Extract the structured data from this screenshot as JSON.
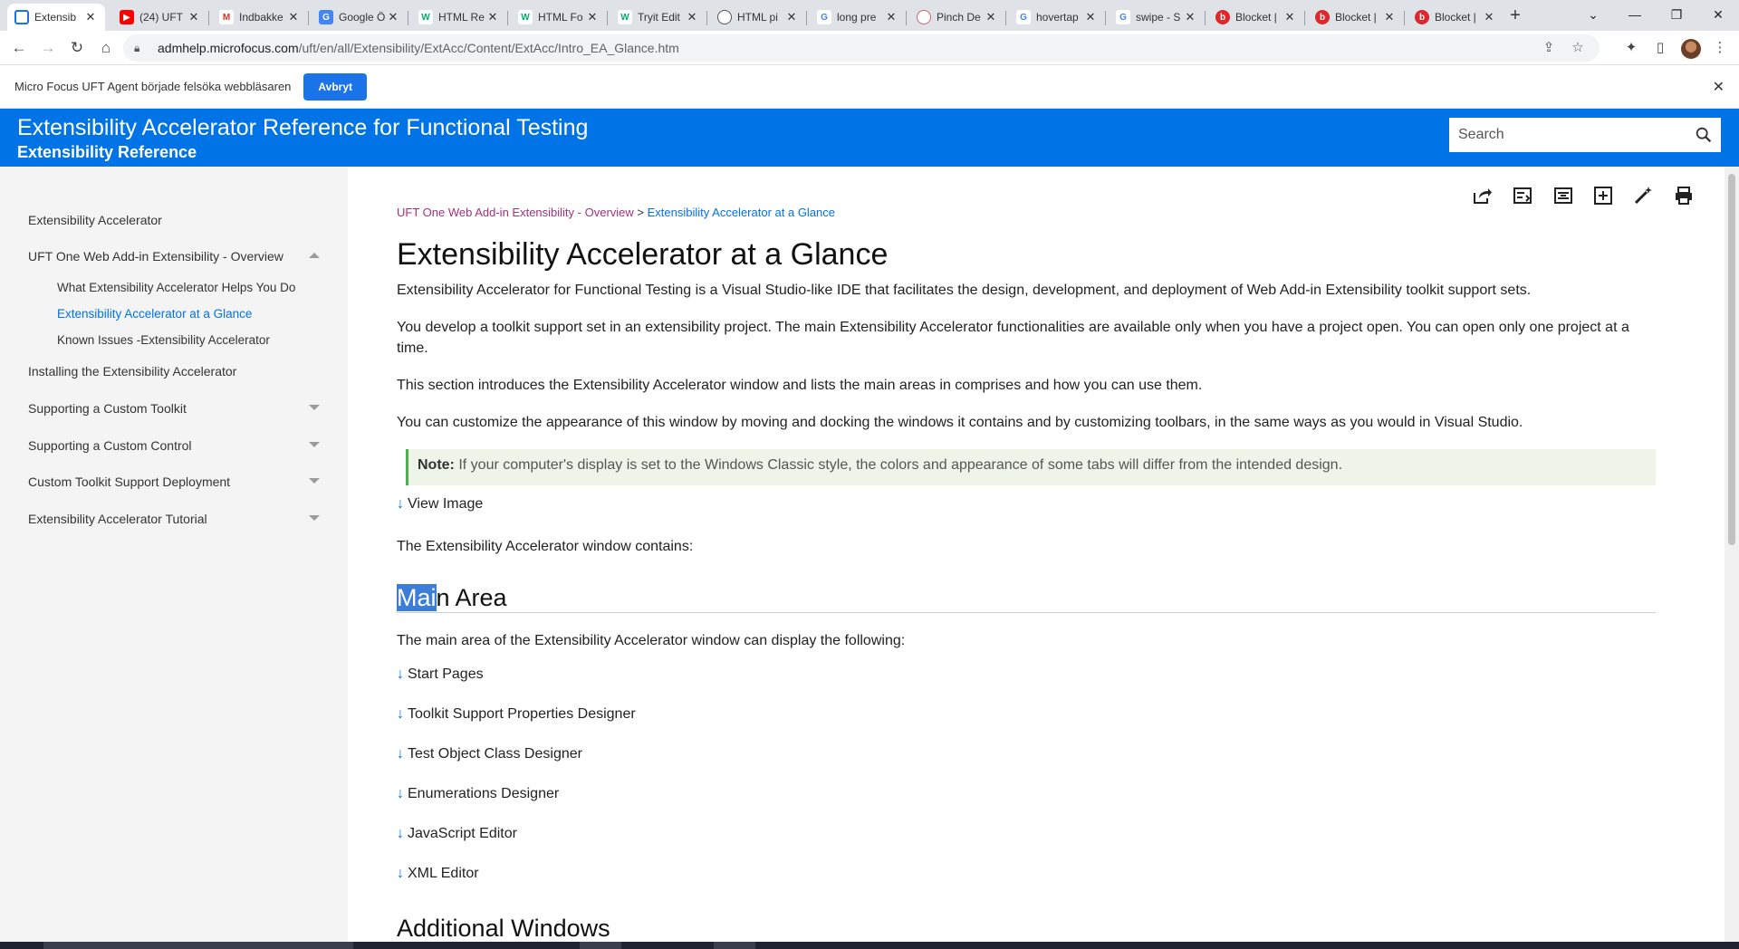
{
  "browser": {
    "tabs": [
      {
        "label": "Extensib",
        "icon": "microfocus-icon",
        "color": "#1a73e8"
      },
      {
        "label": "(24) UFT",
        "icon": "youtube-icon",
        "color": "#ff0000"
      },
      {
        "label": "Indbakke",
        "icon": "gmail-icon",
        "color": "#d93025"
      },
      {
        "label": "Google Ö",
        "icon": "translate-icon",
        "color": "#4285f4"
      },
      {
        "label": "HTML Re",
        "icon": "w3schools-icon",
        "color": "#04aa6d"
      },
      {
        "label": "HTML Fo",
        "icon": "w3schools-icon",
        "color": "#04aa6d"
      },
      {
        "label": "Tryit Edit",
        "icon": "w3schools-icon",
        "color": "#04aa6d"
      },
      {
        "label": "HTML pi",
        "icon": "globe-icon",
        "color": "#555555"
      },
      {
        "label": "long pre",
        "icon": "google-icon",
        "color": "#4285f4"
      },
      {
        "label": "Pinch De",
        "icon": "site-icon",
        "color": "#cc6666"
      },
      {
        "label": "hovertap",
        "icon": "google-icon",
        "color": "#4285f4"
      },
      {
        "label": "swipe - S",
        "icon": "google-icon",
        "color": "#4285f4"
      },
      {
        "label": "Blocket |",
        "icon": "blocket-icon",
        "color": "#e0262a"
      },
      {
        "label": "Blocket |",
        "icon": "blocket-icon",
        "color": "#e0262a"
      },
      {
        "label": "Blocket |",
        "icon": "blocket-icon",
        "color": "#e0262a"
      }
    ],
    "url_host": "admhelp.microfocus.com",
    "url_path": "/uft/en/all/Extensibility/ExtAcc/Content/ExtAcc/Intro_EA_Glance.htm",
    "infobar": {
      "message": "Micro Focus UFT Agent började felsöka webbläsaren",
      "button": "Avbryt"
    }
  },
  "header": {
    "title": "Extensibility Accelerator Reference for Functional Testing",
    "subtitle": "Extensibility Reference",
    "search_placeholder": "Search",
    "color": "#0073e7"
  },
  "sidebar": {
    "items": [
      {
        "label": "Extensibility Accelerator",
        "level": 0
      },
      {
        "label": "UFT One Web Add-in Extensibility - Overview",
        "level": 0,
        "expanded": true
      },
      {
        "label": "What Extensibility Accelerator Helps You Do",
        "level": 1
      },
      {
        "label": "Extensibility Accelerator at a Glance",
        "level": 1,
        "current": true
      },
      {
        "label": "Known Issues -Extensibility Accelerator",
        "level": 1
      },
      {
        "label": "Installing the Extensibility Accelerator",
        "level": 0
      },
      {
        "label": "Supporting a Custom Toolkit",
        "level": 0,
        "expandable": true
      },
      {
        "label": "Supporting a Custom Control",
        "level": 0,
        "expandable": true
      },
      {
        "label": "Custom Toolkit Support Deployment",
        "level": 0,
        "expandable": true
      },
      {
        "label": "Extensibility Accelerator Tutorial",
        "level": 0,
        "expandable": true
      }
    ]
  },
  "content": {
    "breadcrumb": {
      "parent": "UFT One Web Add-in Extensibility - Overview",
      "separator": ">",
      "current": "Extensibility Accelerator at a Glance"
    },
    "title": "Extensibility Accelerator at a Glance",
    "paragraphs": [
      "Extensibility Accelerator for Functional Testing is a Visual Studio-like IDE that facilitates the design, development, and deployment of Web Add-in Extensibility toolkit support sets.",
      "You develop a toolkit support set in an extensibility project. The main Extensibility Accelerator functionalities are available only when you have a project open. You can open only one project at a time.",
      "This section introduces the Extensibility Accelerator window and lists the main areas in comprises and how you can use them.",
      "You can customize the appearance of this window by moving and docking the windows it contains and by customizing toolbars, in the same ways as you would in Visual Studio."
    ],
    "note": {
      "label": "Note:",
      "text": "If your computer's display is set to the Windows Classic style, the colors and appearance of some tabs will differ from the intended design."
    },
    "view_image": "View Image",
    "window_contains": "The Extensibility Accelerator window contains:",
    "main_area": {
      "heading_selected": "Mai",
      "heading_rest": "n Area",
      "intro": "The main area of the Extensibility Accelerator window can display the following:",
      "items": [
        "Start Pages",
        "Toolkit Support Properties Designer",
        "Test Object Class Designer",
        "Enumerations Designer",
        "JavaScript Editor",
        "XML Editor"
      ]
    },
    "additional_heading": "Additional Windows"
  }
}
